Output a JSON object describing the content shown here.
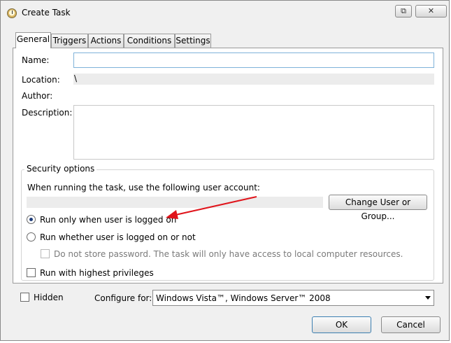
{
  "window": {
    "title": "Create Task"
  },
  "icons": {
    "title": "clock-icon",
    "restore": "restore-icon",
    "close": "close-icon"
  },
  "tabs": [
    "General",
    "Triggers",
    "Actions",
    "Conditions",
    "Settings"
  ],
  "general": {
    "name_label": "Name:",
    "name_value": "",
    "location_label": "Location:",
    "location_value": "\\",
    "author_label": "Author:",
    "author_value": "",
    "description_label": "Description:",
    "description_value": ""
  },
  "security": {
    "title": "Security options",
    "account_prompt": "When running the task, use the following user account:",
    "account_value": "",
    "change_button": "Change User or Group...",
    "radio_logged_on": {
      "label": "Run only when user is logged on",
      "checked": true
    },
    "radio_whether": {
      "label": "Run whether user is logged on or not",
      "checked": false
    },
    "no_store_password": {
      "label": "Do not store password.  The task will only have access to local computer resources.",
      "checked": false,
      "enabled": false
    },
    "highest_privileges": {
      "label": "Run with highest privileges",
      "checked": false
    }
  },
  "bottom": {
    "hidden_label": "Hidden",
    "hidden_checked": false,
    "configure_label": "Configure for:",
    "configure_value": "Windows Vista™, Windows Server™ 2008"
  },
  "buttons": {
    "ok": "OK",
    "cancel": "Cancel"
  },
  "colors": {
    "annotation_arrow": "#e0141b",
    "focus_border": "#7fb2d9"
  }
}
